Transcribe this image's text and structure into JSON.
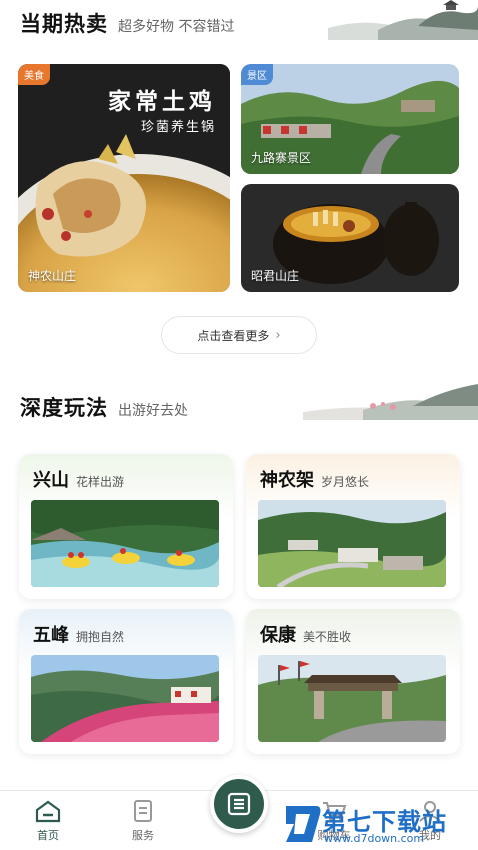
{
  "hot": {
    "title": "当期热卖",
    "subtitle": "超多好物 不容错过",
    "cards": [
      {
        "badge": "美食",
        "name": "神农山庄",
        "banner_title": "家常土鸡",
        "banner_sub": "珍菌养生锅",
        "badge_color": "#e8772e"
      },
      {
        "badge": "景区",
        "name": "九路寨景区",
        "badge_color": "#4f8ad4"
      },
      {
        "name": "昭君山庄"
      }
    ],
    "more_label": "点击查看更多"
  },
  "play": {
    "title": "深度玩法",
    "subtitle": "出游好去处",
    "tiles": [
      {
        "name": "兴山",
        "slogan": "花样出游"
      },
      {
        "name": "神农架",
        "slogan": "岁月悠长"
      },
      {
        "name": "五峰",
        "slogan": "拥抱自然"
      },
      {
        "name": "保康",
        "slogan": "美不胜收"
      }
    ]
  },
  "nav": {
    "items": [
      {
        "label": "首页",
        "icon": "home-icon",
        "active": true
      },
      {
        "label": "服务",
        "icon": "service-icon"
      },
      {
        "label": "购物车",
        "icon": "cart-icon"
      },
      {
        "label": "我的",
        "icon": "profile-icon"
      }
    ],
    "center_icon": "menu-list-icon",
    "active_color": "#2f5b4c"
  },
  "watermark": {
    "text": "第七下载站",
    "url": "www.d7down.com"
  }
}
